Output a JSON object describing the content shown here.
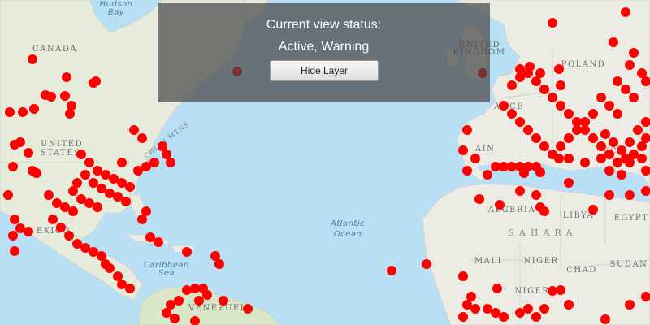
{
  "status": {
    "title": "Current view status:",
    "value": "Active, Warning",
    "button_label": "Hide Layer"
  },
  "map": {
    "labels": {
      "hudson_bay_1": "Hudson",
      "hudson_bay_2": "Bay",
      "canada": "CANADA",
      "united_states_1": "UNITED",
      "united_states_2": "STATES",
      "appalachian": "CHIAN MTNS",
      "mexico": "EXICO",
      "caribbean_1": "Caribbean",
      "caribbean_2": "Sea",
      "venezuela": "VENEZUELA",
      "atlantic_1": "Atlantic",
      "atlantic_2": "Ocean",
      "united_kingdom_1": "UNITED",
      "united_kingdom_2": "KINGDOM",
      "poland": "POLAND",
      "france": "ANCE",
      "spain": "AIN",
      "greece": "ECE",
      "algeria": "ALGERIA",
      "libya": "LIBYA",
      "egypt": "EGYPT",
      "sahara": "SAHARA",
      "mali": "MALI",
      "niger": "NIGER",
      "chad": "CHAD",
      "sudan": "SUDAN",
      "nigeria": "NIGERIA"
    },
    "colors": {
      "ocean": "#b9dff5",
      "land": "#ecebe4",
      "land_green": "#d9e6c8",
      "marker": "#ff0000"
    }
  }
}
